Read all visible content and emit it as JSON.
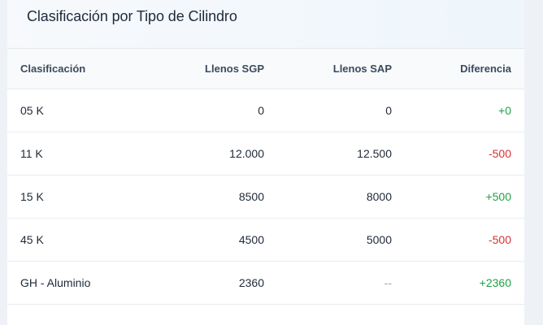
{
  "card": {
    "title": "Clasificación por Tipo de Cilindro"
  },
  "table": {
    "headers": [
      "Clasificación",
      "Llenos SGP",
      "Llenos SAP",
      "Diferencia"
    ],
    "rows": [
      {
        "clasificacion": "05 K",
        "sgp": "0",
        "sap": "0",
        "diferencia": "+0",
        "status": "positive"
      },
      {
        "clasificacion": "11 K",
        "sgp": "12.000",
        "sap": "12.500",
        "diferencia": "-500",
        "status": "negative"
      },
      {
        "clasificacion": "15 K",
        "sgp": "8500",
        "sap": "8000",
        "diferencia": "+500",
        "status": "positive"
      },
      {
        "clasificacion": "45 K",
        "sgp": "4500",
        "sap": "5000",
        "diferencia": "-500",
        "status": "negative"
      },
      {
        "clasificacion": "GH - Aluminio",
        "sgp": "2360",
        "sap": "--",
        "diferencia": "+2360",
        "status": "positive"
      }
    ]
  },
  "colors": {
    "positive": "#22a047",
    "negative": "#d63232"
  }
}
